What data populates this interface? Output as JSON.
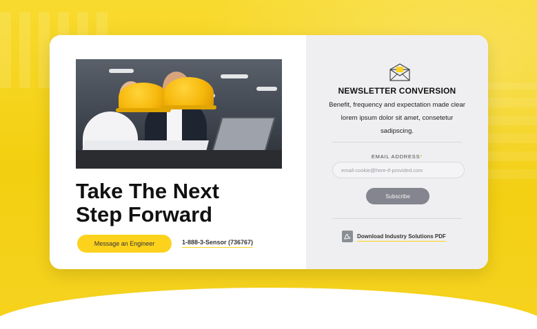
{
  "hero": {
    "headline_line1": "Take The Next",
    "headline_line2": "Step Forward",
    "cta_label": "Message an Engineer",
    "phone": "1-888-3-Sensor (736767)"
  },
  "newsletter": {
    "title": "NEWSLETTER CONVERSION",
    "description": "Benefit, frequency and expectation made clear lorem ipsum dolor sit amet, consetetur sadipscing.",
    "email_label": "EMAIL ADDRESS",
    "required_mark": "*",
    "email_placeholder": "email-cookie@here-if-provided.com",
    "subscribe_label": "Subscribe",
    "pdf_link": "Download Industry Solutions PDF"
  },
  "icons": {
    "envelope": "envelope-icon",
    "pdf": "pdf-icon"
  },
  "colors": {
    "accent_yellow": "#fcd21d",
    "panel_gray": "#efeff1",
    "button_gray": "#85858f"
  }
}
